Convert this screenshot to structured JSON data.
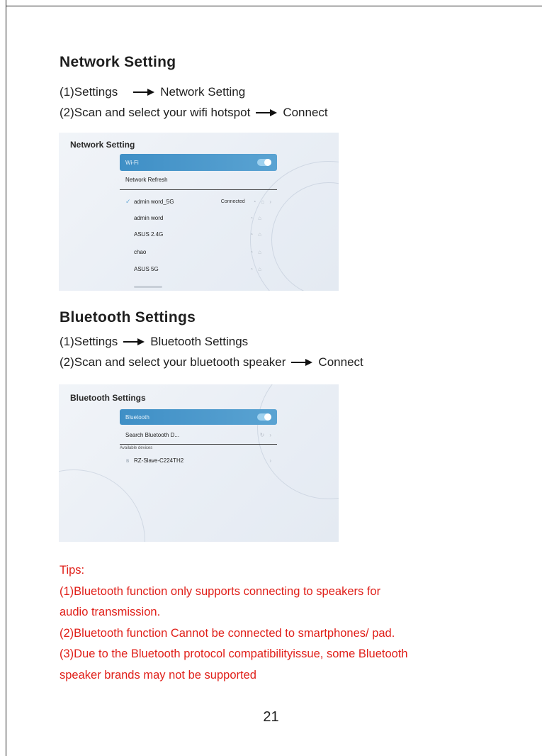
{
  "network_section": {
    "heading": "Network Setting",
    "step1_prefix": "(1)Settings",
    "step1_target": "Network Setting",
    "step2_prefix": "(2)Scan and select your wifi hotspot",
    "step2_target": "Connect",
    "screen": {
      "title": "Network Setting",
      "wifi_label": "Wi-Fi",
      "refresh_label": "Network Refresh",
      "networks": [
        {
          "name": "admin word_5G",
          "status": "Connected",
          "selected": true
        },
        {
          "name": "admin word",
          "status": "",
          "selected": false
        },
        {
          "name": "ASUS 2.4G",
          "status": "",
          "selected": false
        },
        {
          "name": "chao",
          "status": "",
          "selected": false
        },
        {
          "name": "ASUS 5G",
          "status": "",
          "selected": false
        }
      ]
    }
  },
  "bluetooth_section": {
    "heading": "Bluetooth Settings",
    "step1_prefix": "(1)Settings",
    "step1_target": "Bluetooth Settings",
    "step2_prefix": "(2)Scan and select your bluetooth speaker",
    "step2_target": "Connect",
    "screen": {
      "title": "Bluetooth Settings",
      "bluetooth_label": "Bluetooth",
      "search_label": "Search Bluetooth D...",
      "available_label": "Available devices",
      "device_name": "RZ-Slave-C224TH2"
    }
  },
  "tips": {
    "title": "Tips:",
    "line1": "(1)Bluetooth function only supports connecting to speakers for",
    "line2": "audio transmission.",
    "line3": "(2)Bluetooth function Cannot be connected to smartphones/ pad.",
    "line4": "(3)Due to the Bluetooth protocol compatibilityissue, some Bluetooth",
    "line5": "speaker brands may not be supported"
  },
  "page_number": "21",
  "colors": {
    "accent": "#4a98cc",
    "tips": "#e0201a"
  }
}
